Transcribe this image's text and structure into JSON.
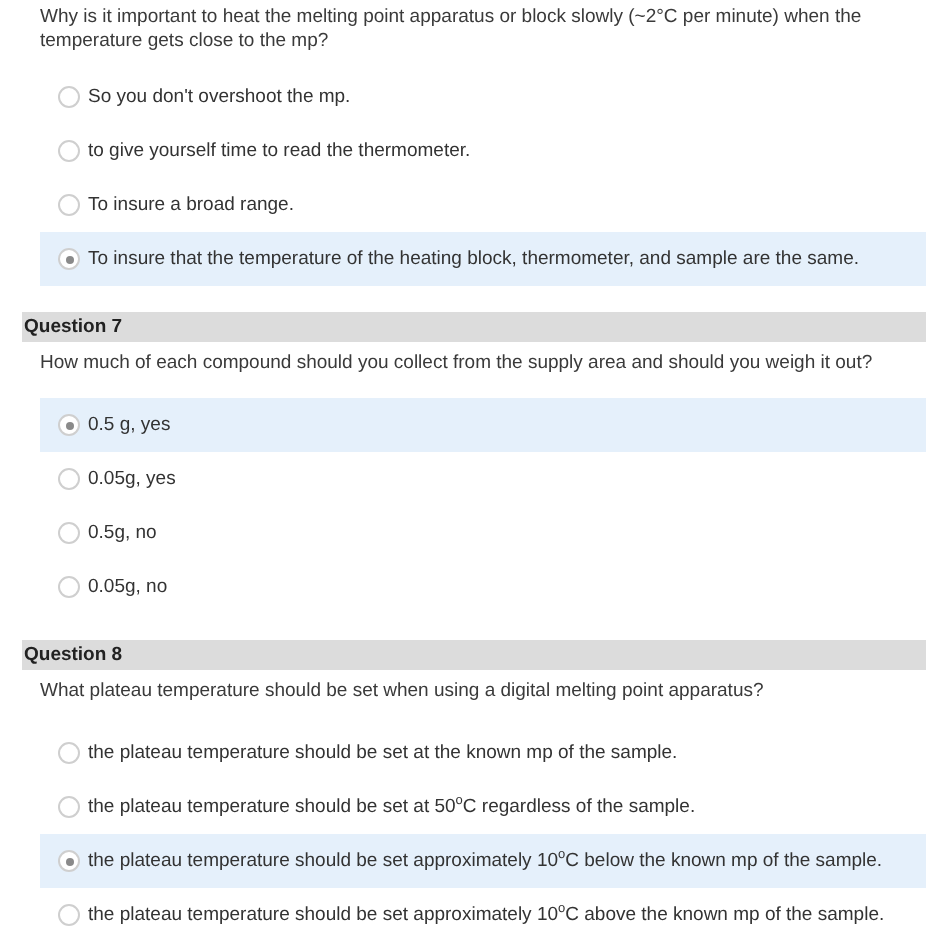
{
  "questions": [
    {
      "prompt": "Why is it important to heat the melting point apparatus or block slowly (~2°C per minute) when the temperature gets close to the mp?",
      "options": [
        {
          "label": "So you don't overshoot the mp.",
          "selected": false
        },
        {
          "label": "to give yourself time to read the thermometer.",
          "selected": false
        },
        {
          "label": "To insure a broad range.",
          "selected": false
        },
        {
          "label": "To insure that the temperature of the heating block, thermometer, and sample are the same.",
          "selected": true
        }
      ]
    },
    {
      "title": "Question 7",
      "prompt": "How much of each compound should you collect from the supply area and should you weigh it out?",
      "options": [
        {
          "label": "0.5 g, yes",
          "selected": true
        },
        {
          "label": "0.05g, yes",
          "selected": false
        },
        {
          "label": "0.5g, no",
          "selected": false
        },
        {
          "label": "0.05g, no",
          "selected": false
        }
      ]
    },
    {
      "title": "Question 8",
      "prompt": "What plateau temperature should be set when using a digital melting point apparatus?",
      "options": [
        {
          "label": "the plateau temperature should be set at the known mp of the sample.",
          "selected": false
        },
        {
          "label": "the plateau temperature should be set at 50$^{o}$C regardless of the sample.",
          "selected": false
        },
        {
          "label": "the plateau temperature should be set approximately 10$^{o}$C below the  known mp of the sample.",
          "selected": true
        },
        {
          "label": "the plateau temperature should be set approximately 10$^{o}$C above the  known mp of the sample.",
          "selected": false
        }
      ]
    }
  ]
}
